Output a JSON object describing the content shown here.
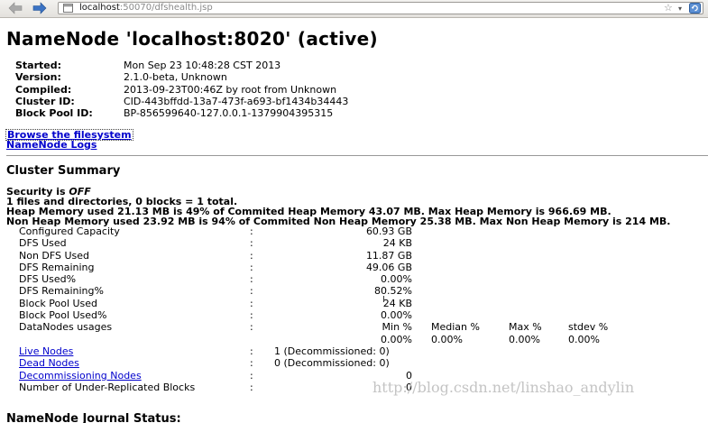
{
  "browser": {
    "url_host": "localhost",
    "url_rest": ":50070/dfshealth.jsp"
  },
  "page": {
    "title": "NameNode 'localhost:8020' (active)",
    "info": [
      {
        "label": "Started:",
        "value": "Mon Sep 23 10:48:28 CST 2013"
      },
      {
        "label": "Version:",
        "value": "2.1.0-beta, Unknown"
      },
      {
        "label": "Compiled:",
        "value": "2013-09-23T00:46Z by root from Unknown"
      },
      {
        "label": "Cluster ID:",
        "value": "CID-443bffdd-13a7-473f-a693-bf1434b34443"
      },
      {
        "label": "Block Pool ID:",
        "value": "BP-856599640-127.0.0.1-1379904395315"
      }
    ],
    "links": {
      "browse": "Browse the filesystem",
      "logs": "NameNode Logs"
    },
    "cluster_summary": {
      "title": "Cluster Summary",
      "security_prefix": "Security is ",
      "security_state": "OFF",
      "files_line": "1 files and directories, 0 blocks = 1 total.",
      "heap_line": "Heap Memory used 21.13 MB is 49% of Commited Heap Memory 43.07 MB. Max Heap Memory is 966.69 MB.",
      "nonheap_line": "Non Heap Memory used 23.92 MB is 94% of Commited Non Heap Memory 25.38 MB. Max Non Heap Memory is 214 MB.",
      "colon": ":",
      "rows": [
        {
          "label": "Configured Capacity",
          "value": "60.93 GB"
        },
        {
          "label": "DFS Used",
          "value": "24 KB"
        },
        {
          "label": "Non DFS Used",
          "value": "11.87 GB"
        },
        {
          "label": "DFS Remaining",
          "value": "49.06 GB"
        },
        {
          "label": "DFS Used%",
          "value": "0.00%"
        },
        {
          "label": "DFS Remaining%",
          "value": "80.52%"
        },
        {
          "label": "Block Pool Used",
          "value": "24 KB"
        },
        {
          "label": "Block Pool Used%",
          "value": "0.00%"
        }
      ],
      "datanodes_usages": {
        "label": "DataNodes usages",
        "headers": [
          "Min %",
          "Median %",
          "Max %",
          "stdev %"
        ],
        "values": [
          "0.00%",
          "0.00%",
          "0.00%",
          "0.00%"
        ]
      },
      "live_nodes": {
        "label": "Live Nodes",
        "value": "1 (Decommissioned: 0)"
      },
      "dead_nodes": {
        "label": "Dead Nodes",
        "value": "0 (Decommissioned: 0)"
      },
      "decommissioning": {
        "label": "Decommissioning Nodes",
        "value": "0"
      },
      "under_replicated": {
        "label": "Number of Under-Replicated Blocks",
        "value": "0"
      }
    },
    "journal_title": "NameNode Journal Status:"
  },
  "watermark": "http://blog.csdn.net/linshao_andylin"
}
